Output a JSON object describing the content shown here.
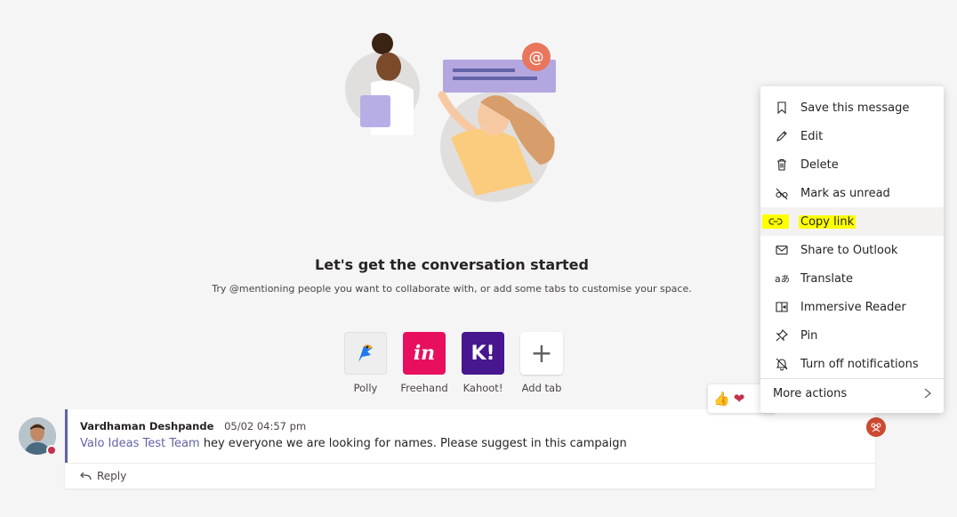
{
  "empty_state": {
    "heading": "Let's get the conversation started",
    "subtext": "Try @mentioning people you want to collaborate with, or add some tabs to customise your space."
  },
  "apps": [
    {
      "label": "Polly",
      "icon": "parrot-icon",
      "color": "#1f7aec"
    },
    {
      "label": "Freehand",
      "tile_text": "in",
      "icon": "invision-icon",
      "color": "#e8105e"
    },
    {
      "label": "Kahoot!",
      "tile_text": "K!",
      "icon": "kahoot-icon",
      "color": "#46178f"
    },
    {
      "label": "Add tab",
      "tile_text": "+",
      "icon": "plus-icon"
    }
  ],
  "message": {
    "author": "Vardhaman Deshpande",
    "timestamp": "05/02 04:57 pm",
    "mention": "Valo Ideas Test Team",
    "text": " hey everyone we are looking for names. Please suggest in this campaign",
    "reply_label": "Reply",
    "presence_color": "#c4314b"
  },
  "reactions": [
    {
      "name": "like",
      "glyph": "👍"
    },
    {
      "name": "heart",
      "glyph": "❤"
    }
  ],
  "context_menu": {
    "items": [
      {
        "label": "Save this message",
        "icon": "bookmark-icon"
      },
      {
        "label": "Edit",
        "icon": "pencil-icon"
      },
      {
        "label": "Delete",
        "icon": "trash-icon"
      },
      {
        "label": "Mark as unread",
        "icon": "unread-icon"
      },
      {
        "label": "Copy link",
        "icon": "link-icon",
        "highlighted": true,
        "highlight_color": "#ffff00"
      },
      {
        "label": "Share to Outlook",
        "icon": "mail-icon"
      },
      {
        "label": "Translate",
        "icon": "translate-icon"
      },
      {
        "label": "Immersive Reader",
        "icon": "immersive-reader-icon"
      },
      {
        "label": "Pin",
        "icon": "pin-icon"
      },
      {
        "label": "Turn off notifications",
        "icon": "bell-off-icon"
      }
    ],
    "more_actions": "More actions"
  },
  "colors": {
    "accent": "#6264a7",
    "background": "#f5f5f5",
    "team_badge": "#cc4a31"
  }
}
